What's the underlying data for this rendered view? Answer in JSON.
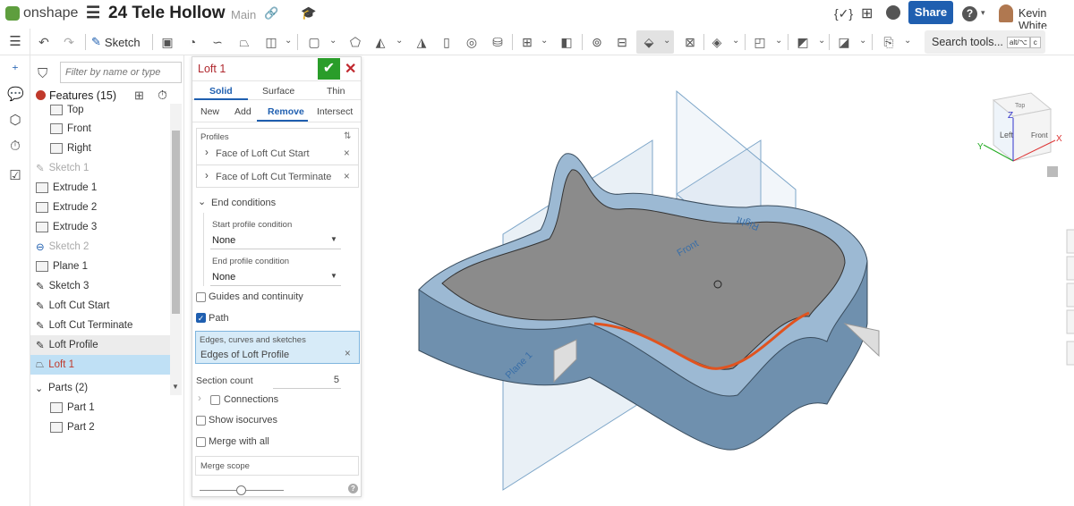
{
  "app": {
    "brand": "onshape",
    "doc_title": "24 Tele Hollow",
    "branch": "Main",
    "share": "Share",
    "user": "Kevin White",
    "brand_color": "#5e9e3e"
  },
  "toolbar": {
    "sketch": "Sketch",
    "search": "Search tools...",
    "shortcut1": "alt/⌥",
    "shortcut2": "c"
  },
  "tree": {
    "filter_placeholder": "Filter by name or type",
    "features_header": "Features (15)",
    "items": [
      {
        "label": "Top",
        "state": "normal"
      },
      {
        "label": "Front",
        "state": "normal"
      },
      {
        "label": "Right",
        "state": "normal"
      },
      {
        "label": "Sketch 1",
        "state": "dim"
      },
      {
        "label": "Extrude 1",
        "state": "normal"
      },
      {
        "label": "Extrude 2",
        "state": "normal"
      },
      {
        "label": "Extrude 3",
        "state": "normal"
      },
      {
        "label": "Sketch 2",
        "state": "dim"
      },
      {
        "label": "Plane 1",
        "state": "normal"
      },
      {
        "label": "Sketch 3",
        "state": "normal"
      },
      {
        "label": "Loft Cut Start",
        "state": "normal"
      },
      {
        "label": "Loft Cut Terminate",
        "state": "normal"
      },
      {
        "label": "Loft Profile",
        "state": "hover"
      },
      {
        "label": "Loft 1",
        "state": "selected"
      }
    ],
    "parts_header": "Parts (2)",
    "parts": [
      "Part 1",
      "Part 2"
    ]
  },
  "dialog": {
    "title": "Loft 1",
    "tabs": [
      "Solid",
      "Surface",
      "Thin"
    ],
    "ops": [
      "New",
      "Add",
      "Remove",
      "Intersect"
    ],
    "profiles_label": "Profiles",
    "profiles": [
      "Face of Loft Cut Start",
      "Face of Loft Cut Terminate"
    ],
    "end_conditions": "End conditions",
    "start_label": "Start profile condition",
    "start_value": "None",
    "end_label": "End profile condition",
    "end_value": "None",
    "guides": "Guides and continuity",
    "path": "Path",
    "edges_label": "Edges, curves and sketches",
    "edges_value": "Edges of Loft Profile",
    "section_count_label": "Section count",
    "section_count": "5",
    "connections": "Connections",
    "isocurves": "Show isocurves",
    "merge_all": "Merge with all",
    "merge_scope": "Merge scope",
    "slider_value": 0.5
  },
  "viewport": {
    "planes": [
      "Front",
      "Right",
      "Plane 1"
    ],
    "cube": [
      "Left",
      "Front",
      "Top"
    ],
    "axes": [
      "X",
      "Y",
      "Z"
    ]
  }
}
